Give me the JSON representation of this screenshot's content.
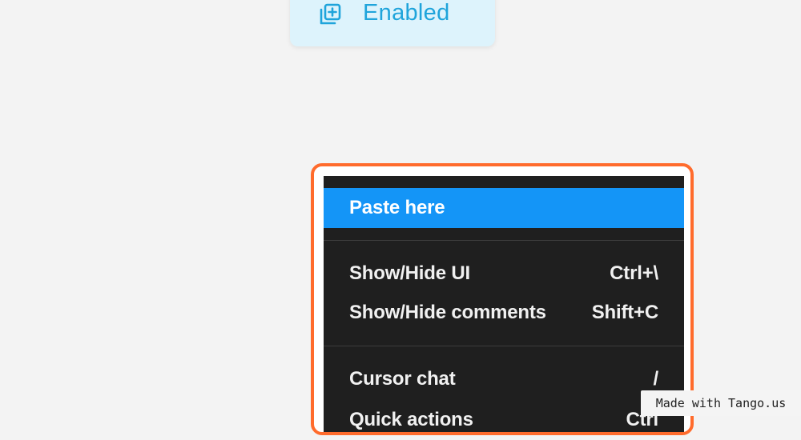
{
  "status_pill": {
    "icon": "add-copy-icon",
    "label": "Enabled",
    "accent_color": "#1fa4db",
    "background_color": "#ddf3fc"
  },
  "context_menu": {
    "highlight_color": "#ff6b2c",
    "active_color": "#1495f7",
    "items": [
      {
        "label": "Paste here",
        "shortcut": ""
      },
      {
        "label": "Show/Hide UI",
        "shortcut": "Ctrl+\\"
      },
      {
        "label": "Show/Hide comments",
        "shortcut": "Shift+C"
      },
      {
        "label": "Cursor chat",
        "shortcut": "/"
      },
      {
        "label": "Quick actions",
        "shortcut": "Ctrl"
      }
    ]
  },
  "watermark": {
    "text": "Made with Tango.us"
  }
}
